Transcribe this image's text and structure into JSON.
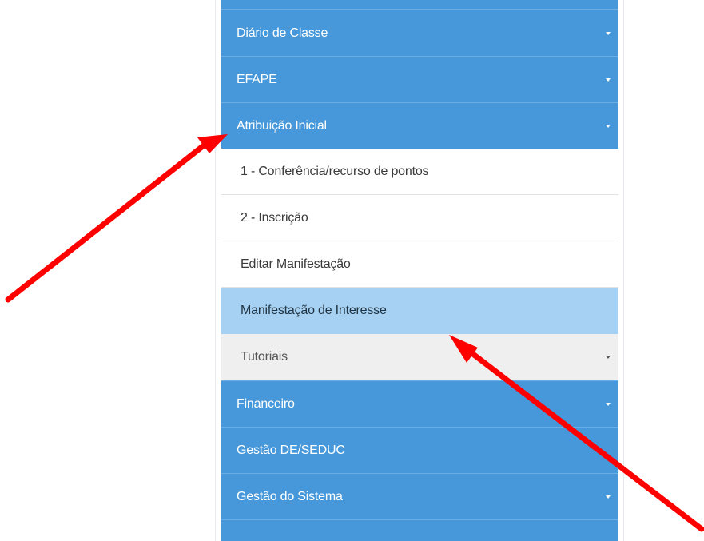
{
  "menu": {
    "items": [
      {
        "label": "Diário de Classe"
      },
      {
        "label": "EFAPE"
      },
      {
        "label": "Atribuição Inicial"
      },
      {
        "label": "Financeiro"
      },
      {
        "label": "Gestão DE/SEDUC"
      },
      {
        "label": "Gestão do Sistema"
      }
    ],
    "submenu": {
      "items": [
        {
          "label": "1 - Conferência/recurso de pontos"
        },
        {
          "label": "2 - Inscrição"
        },
        {
          "label": "Editar Manifestação"
        },
        {
          "label": "Manifestação de Interesse"
        },
        {
          "label": "Tutoriais"
        }
      ]
    }
  },
  "colors": {
    "menu_blue": "#4698da",
    "active_highlight": "#a6d1f2",
    "submenu_grey": "#efefef",
    "annotation_arrow": "#ff0000"
  },
  "icons": {
    "caret": "caret-down-icon",
    "annotation": "red-arrow-icon"
  }
}
